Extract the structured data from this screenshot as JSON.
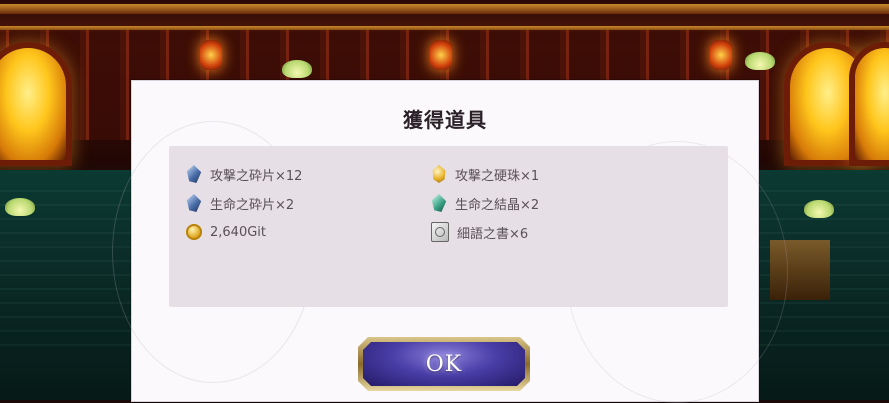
{
  "dialog": {
    "title": "獲得道具",
    "items": [
      {
        "label": "攻撃之砕片×12",
        "icon": "blue-gem-shard-icon"
      },
      {
        "label": "攻撃之硬珠×1",
        "icon": "gold-orb-icon"
      },
      {
        "label": "生命之砕片×2",
        "icon": "blue-gem-shard-icon"
      },
      {
        "label": "生命之結晶×2",
        "icon": "teal-crystal-icon"
      },
      {
        "label": "2,640Git",
        "icon": "gold-coin-icon"
      },
      {
        "label": "細語之書×6",
        "icon": "book-icon"
      }
    ],
    "ok_label": "OK"
  },
  "colors": {
    "dialog_bg": "#fbf9fb",
    "items_panel_bg": "#e7dfe6",
    "ok_button_fill": "#4a3ea8",
    "ok_button_frame": "#d9c58a"
  }
}
